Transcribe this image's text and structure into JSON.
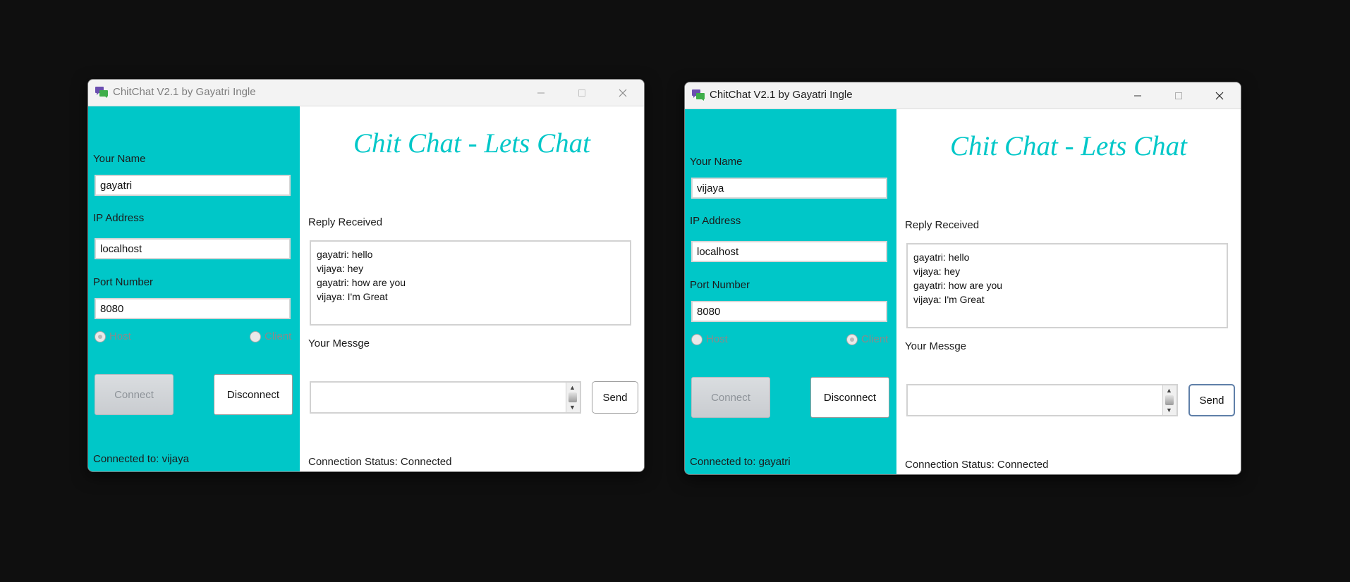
{
  "colors": {
    "panel": "#00c7c8",
    "heading": "#00c7c8",
    "desktop": "#0f0f0f"
  },
  "windows": [
    {
      "title": "ChitChat V2.1 by Gayatri Ingle",
      "icon": "chat-bubbles-icon",
      "focused": false,
      "left": {
        "name_label": "Your Name",
        "name_value": "gayatri",
        "ip_label": "IP Address",
        "ip_value": "localhost",
        "port_label": "Port Number",
        "port_value": "8080",
        "radio_host": "Host",
        "radio_client": "Client",
        "selected_mode": "Host",
        "connect_label": "Connect",
        "disconnect_label": "Disconnect",
        "connected_to": "Connected to: vijaya"
      },
      "right": {
        "heading": "Chit Chat - Lets Chat",
        "reply_label": "Reply Received",
        "messages": [
          "gayatri: hello",
          "vijaya: hey",
          "gayatri: how are you",
          "vijaya: I'm Great"
        ],
        "your_message_label": "Your Messge",
        "message_value": "",
        "send_label": "Send",
        "status": "Connection Status: Connected"
      }
    },
    {
      "title": "ChitChat V2.1 by Gayatri Ingle",
      "icon": "chat-bubbles-icon",
      "focused": true,
      "left": {
        "name_label": "Your Name",
        "name_value": "vijaya",
        "ip_label": "IP Address",
        "ip_value": "localhost",
        "port_label": "Port Number",
        "port_value": "8080",
        "radio_host": "Host",
        "radio_client": "Client",
        "selected_mode": "Client",
        "connect_label": "Connect",
        "disconnect_label": "Disconnect",
        "connected_to": "Connected to: gayatri"
      },
      "right": {
        "heading": "Chit Chat - Lets Chat",
        "reply_label": "Reply Received",
        "messages": [
          "gayatri: hello",
          "vijaya: hey",
          "gayatri: how are you",
          "vijaya: I'm Great"
        ],
        "your_message_label": "Your Messge",
        "message_value": "",
        "send_label": "Send",
        "status": "Connection Status: Connected"
      }
    }
  ]
}
